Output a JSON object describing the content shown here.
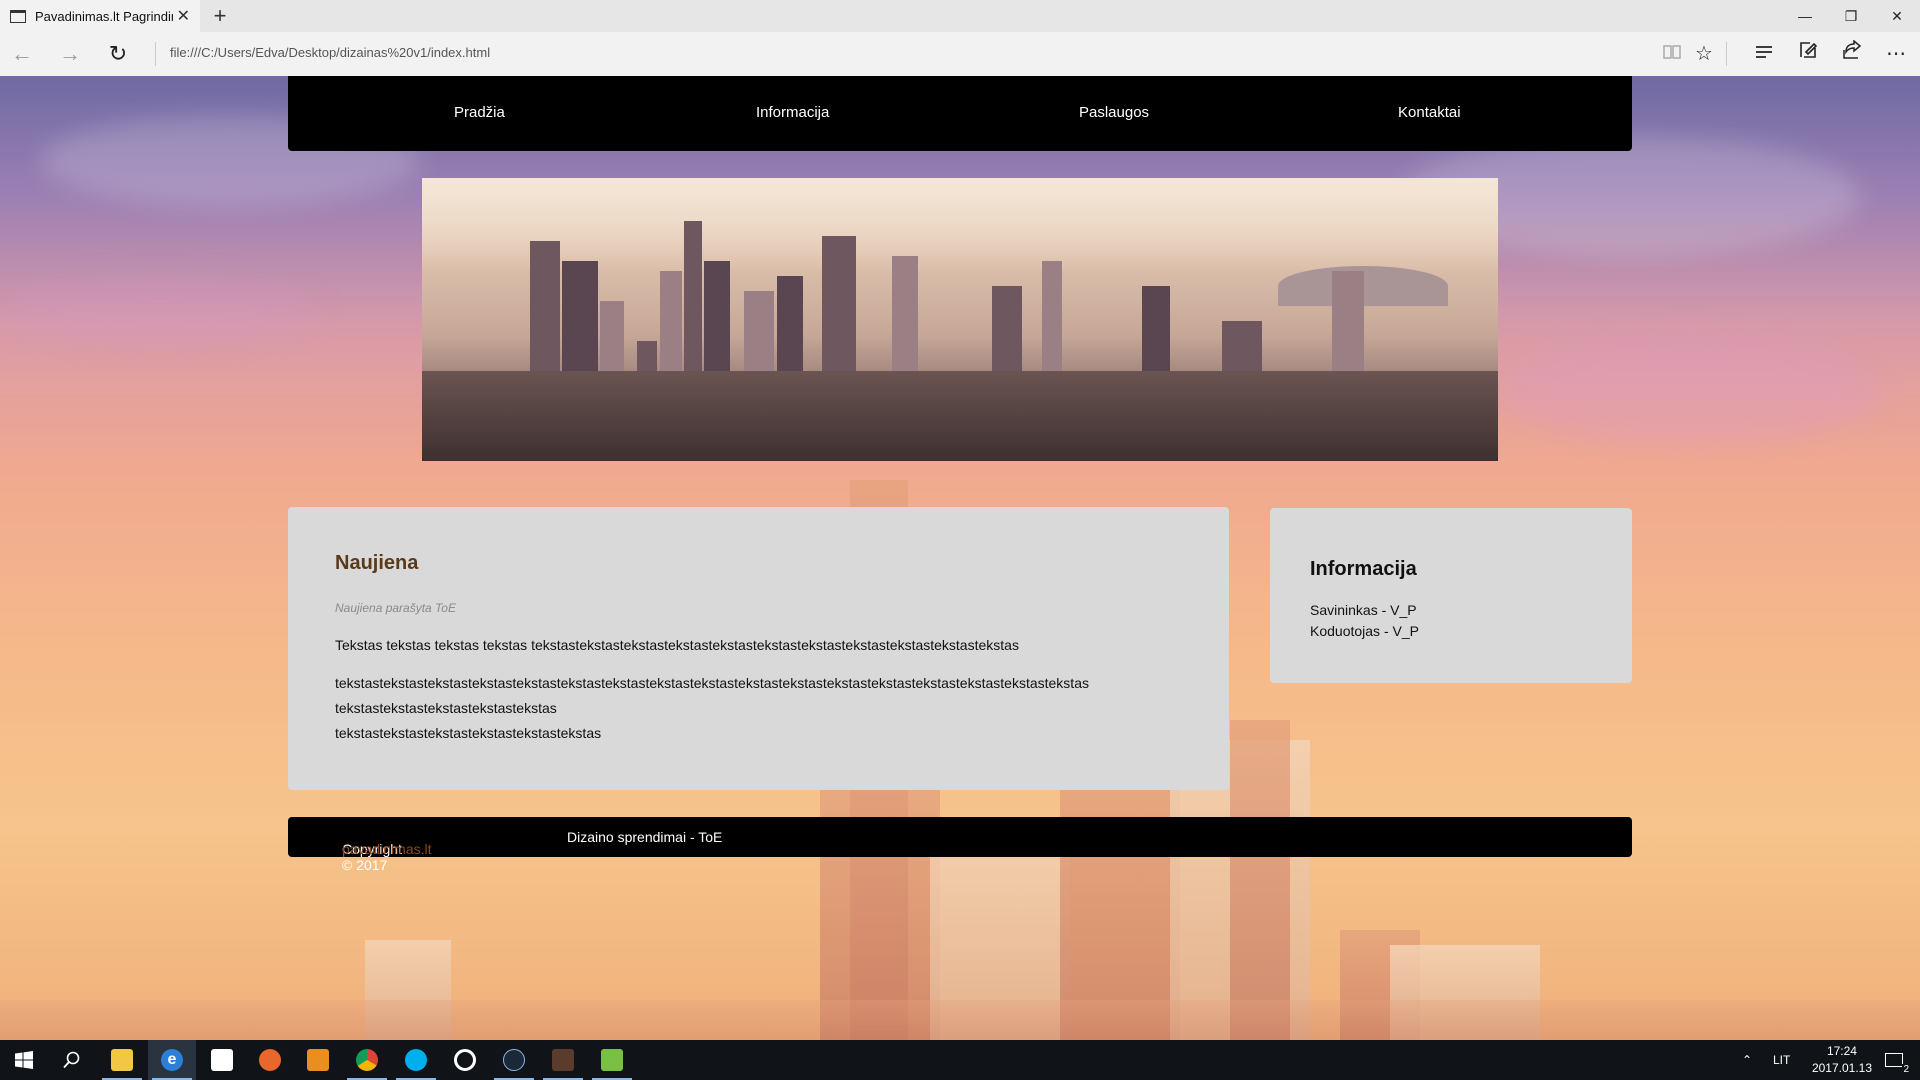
{
  "browser": {
    "tab_title": "Pavadinimas.lt Pagrindinis",
    "tab_close": "✕",
    "new_tab": "+",
    "url": "file:///C:/Users/Edva/Desktop/dizainas%20v1/index.html",
    "window_controls": {
      "minimize": "—",
      "maximize": "❐",
      "close": "✕"
    },
    "icons": [
      "back-icon",
      "forward-icon",
      "refresh-icon",
      "reading-view-icon",
      "favorite-star-icon",
      "hub-icon",
      "web-note-icon",
      "share-icon",
      "more-icon"
    ]
  },
  "site": {
    "nav": [
      "Pradžia",
      "Informacija",
      "Paslaugos",
      "Kontaktai"
    ],
    "news": {
      "title": "Naujiena",
      "meta": "Naujiena parašyta ToE",
      "paragraph1": "Tekstas tekstas tekstas tekstas tekstastekstastekstastekstastekstastekstastekstastekstastekstastekstastekstas",
      "paragraph2_line1": "tekstastekstastekstastekstastekstastekstastekstastekstastekstastekstastekstastekstastekstastekstastekstastekstastekstas",
      "paragraph2_line2": "tekstastekstastekstastekstastekstas",
      "paragraph2_line3": "tekstastekstastekstastekstastekstastekstas"
    },
    "sidebar": {
      "title": "Informacija",
      "owner": "Savininkas - V_P",
      "coder": "Koduotojas - V_P"
    },
    "footer": {
      "copyright": "Copyright © 2017",
      "site_link": "pavadinimas.lt",
      "design": "Dizaino sprendimai - ToE"
    }
  },
  "taskbar": {
    "apps": [
      "windows-start-icon",
      "search-icon",
      "file-explorer-icon",
      "edge-icon",
      "store-icon",
      "firefox-icon",
      "media-player-icon",
      "chrome-icon",
      "skype-icon",
      "groove-icon",
      "steam-icon",
      "game-icon",
      "notepad-icon"
    ],
    "language": "LIT",
    "time": "17:24",
    "date": "2017.01.13",
    "notifications": "2"
  },
  "colors": {
    "nav_bg": "#000000",
    "card_bg": "#d9d9d9",
    "news_title": "#5b3a1a",
    "link_brown": "#8c4a1f"
  }
}
